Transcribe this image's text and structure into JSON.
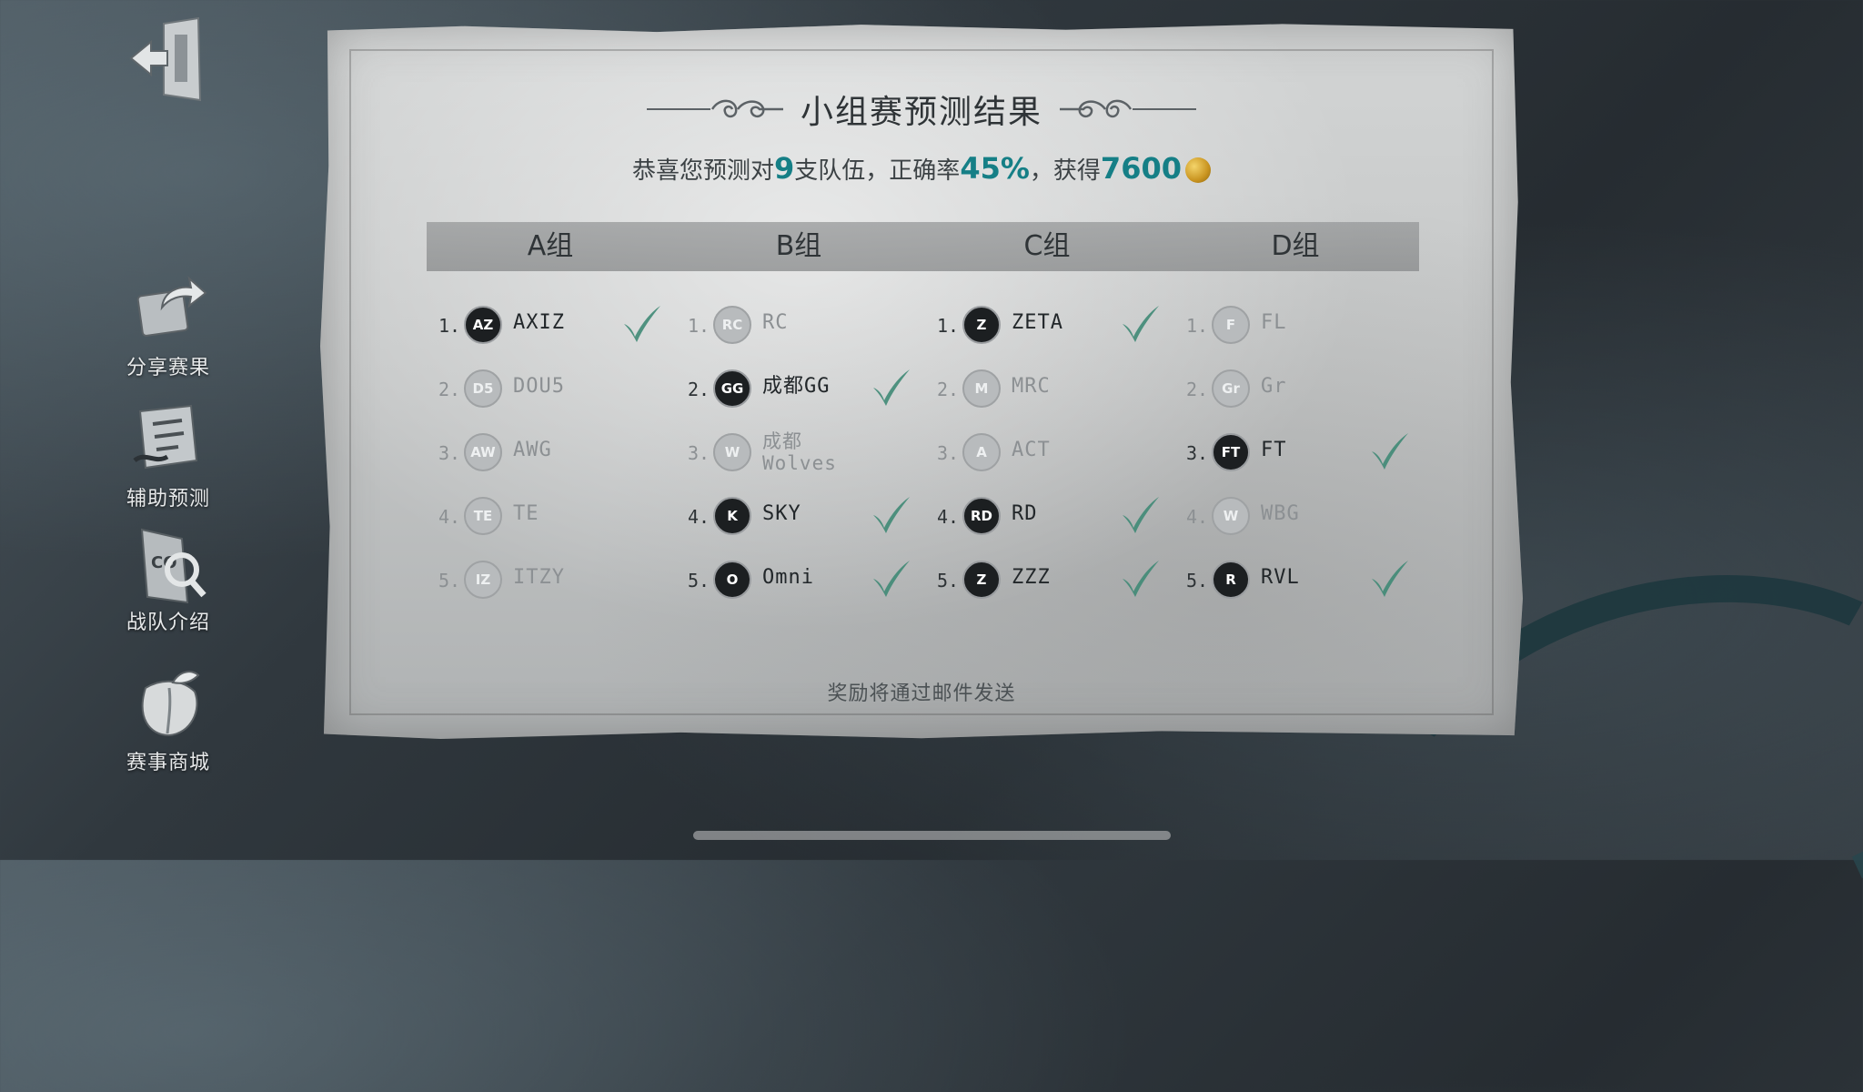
{
  "sidebar": {
    "items": [
      {
        "label": "分享赛果",
        "icon": "share-icon"
      },
      {
        "label": "辅助预测",
        "icon": "prediction-icon"
      },
      {
        "label": "战队介绍",
        "icon": "team-intro-icon"
      },
      {
        "label": "赛事商城",
        "icon": "shop-icon"
      }
    ]
  },
  "result": {
    "title": "小组赛预测结果",
    "summary_prefix": "恭喜您预测对",
    "correct_count": "9",
    "summary_mid1": "支队伍，正确率",
    "accuracy": "45%",
    "summary_mid2": "，获得",
    "reward": "7600",
    "footer": "奖励将通过邮件发送"
  },
  "colors": {
    "highlight": "#157f86",
    "check": "#3f8a75"
  },
  "groups": [
    {
      "name": "A组",
      "teams": [
        {
          "rank": "1.",
          "name": "AXIZ",
          "correct": true,
          "logo": "AZ"
        },
        {
          "rank": "2.",
          "name": "DOU5",
          "correct": false,
          "logo": "D5"
        },
        {
          "rank": "3.",
          "name": "AWG",
          "correct": false,
          "logo": "AW"
        },
        {
          "rank": "4.",
          "name": "TE",
          "correct": false,
          "logo": "TE"
        },
        {
          "rank": "5.",
          "name": "ITZY",
          "correct": false,
          "logo": "IZ"
        }
      ]
    },
    {
      "name": "B组",
      "teams": [
        {
          "rank": "1.",
          "name": "RC",
          "correct": false,
          "logo": "RC"
        },
        {
          "rank": "2.",
          "name": "成都GG",
          "correct": true,
          "logo": "GG"
        },
        {
          "rank": "3.",
          "name": "成都",
          "name2": "Wolves",
          "correct": false,
          "logo": "W"
        },
        {
          "rank": "4.",
          "name": "SKY",
          "correct": true,
          "logo": "K"
        },
        {
          "rank": "5.",
          "name": "Omni",
          "correct": true,
          "logo": "O"
        }
      ]
    },
    {
      "name": "C组",
      "teams": [
        {
          "rank": "1.",
          "name": "ZETA",
          "correct": true,
          "logo": "Z"
        },
        {
          "rank": "2.",
          "name": "MRC",
          "correct": false,
          "logo": "M"
        },
        {
          "rank": "3.",
          "name": "ACT",
          "correct": false,
          "logo": "A"
        },
        {
          "rank": "4.",
          "name": "RD",
          "correct": true,
          "logo": "RD"
        },
        {
          "rank": "5.",
          "name": "ZZZ",
          "correct": true,
          "logo": "Z"
        }
      ]
    },
    {
      "name": "D组",
      "teams": [
        {
          "rank": "1.",
          "name": "FL",
          "correct": false,
          "logo": "F"
        },
        {
          "rank": "2.",
          "name": "Gr",
          "correct": false,
          "logo": "Gr"
        },
        {
          "rank": "3.",
          "name": "FT",
          "correct": true,
          "logo": "FT"
        },
        {
          "rank": "4.",
          "name": "WBG",
          "correct": false,
          "logo": "W"
        },
        {
          "rank": "5.",
          "name": "RVL",
          "correct": true,
          "logo": "R"
        }
      ]
    }
  ]
}
